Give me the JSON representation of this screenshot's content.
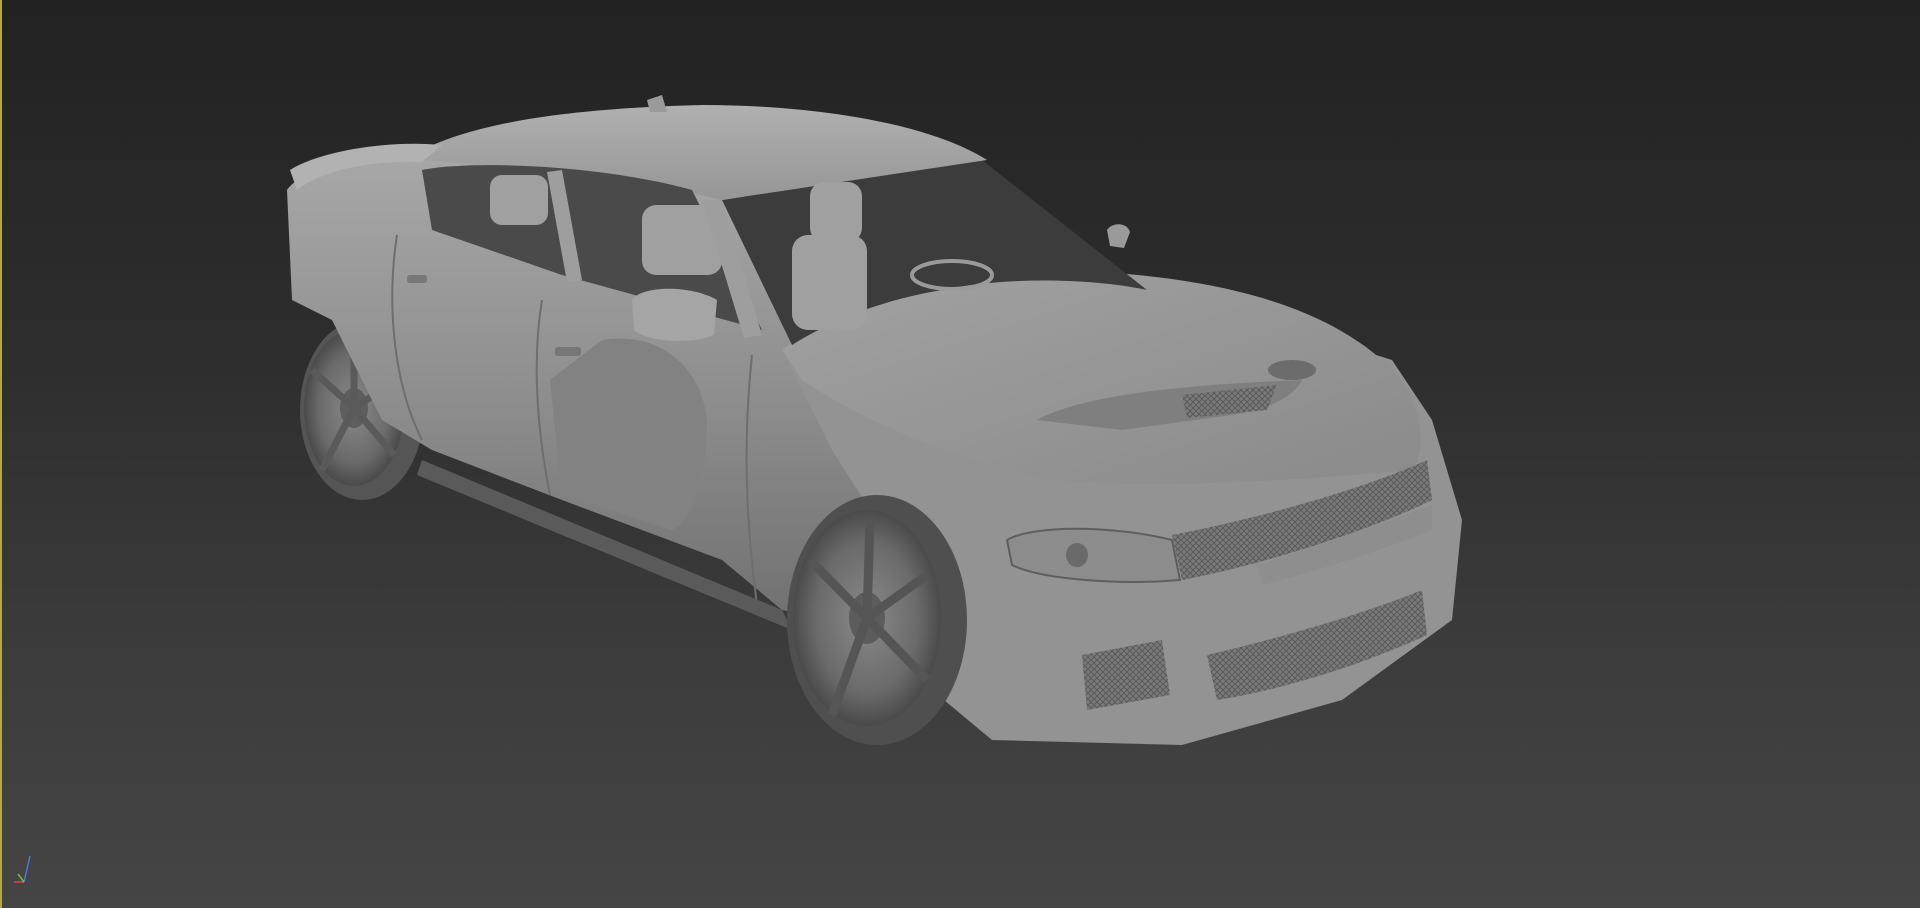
{
  "viewport": {
    "view": "perspective",
    "shading": "default shading",
    "active": true,
    "model_name": "car-model"
  },
  "axis_gizmo": {
    "axes": [
      "x",
      "y",
      "z"
    ],
    "colors": {
      "x": "#d24a3a",
      "y": "#6bbf4a",
      "z": "#4a7bd6"
    }
  },
  "colors": {
    "background_top": "#222222",
    "background_bottom": "#454545",
    "active_border": "#b8a64f",
    "model_base": "#9a9a9a"
  }
}
